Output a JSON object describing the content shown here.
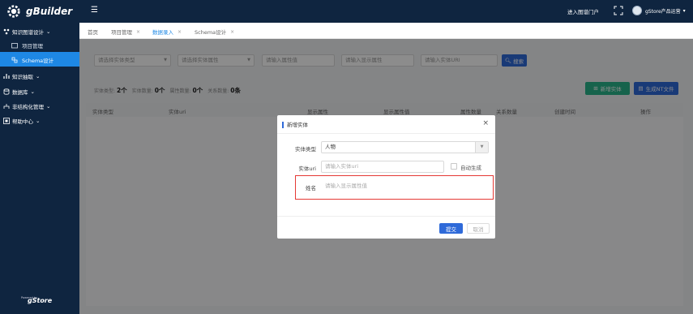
{
  "app": {
    "brand": "gBuilder",
    "footer_brand": "gStore",
    "footer_small": "Powered by"
  },
  "header": {
    "portal_link": "进入图谱门户",
    "user_name": "gStore产品运营"
  },
  "sidebar": {
    "groups": [
      {
        "label": "知识图谱设计",
        "icon": "graph-icon"
      },
      {
        "label": "知识抽取",
        "icon": "chart-icon"
      },
      {
        "label": "数据库",
        "icon": "database-icon"
      },
      {
        "label": "非结构化管理",
        "icon": "sitemap-icon"
      },
      {
        "label": "帮助中心",
        "icon": "help-icon"
      }
    ],
    "sub_items": [
      {
        "label": "项目管理",
        "icon": "folder-icon"
      },
      {
        "label": "Schema设计",
        "icon": "schema-icon"
      }
    ]
  },
  "tabs": [
    {
      "label": "首页"
    },
    {
      "label": "项目管理"
    },
    {
      "label": "数据录入"
    },
    {
      "label": "Schema设计"
    }
  ],
  "filters": {
    "entity_type_placeholder": "请选择实体类型",
    "entity_attr_placeholder": "请选择实体属性",
    "attr_value_placeholder": "请输入属性值",
    "display_attr_placeholder": "请输入显示属性",
    "entity_uri_placeholder": "请输入实体URI",
    "search_label": "搜索"
  },
  "stats": {
    "type_label": "实体类型:",
    "type_value": "2个",
    "entity_label": "实体数量:",
    "entity_value": "0个",
    "attr_label": "属性数量:",
    "attr_value": "0个",
    "relation_label": "关系数量:",
    "relation_value": "0条"
  },
  "actions": {
    "add_entity": "新增实体",
    "generate_nt": "生成NT文件"
  },
  "table": {
    "columns": [
      "实体类型",
      "实体uri",
      "显示属性",
      "显示属性值",
      "属性数量",
      "关系数量",
      "创建时间",
      "操作"
    ]
  },
  "modal": {
    "title": "新增实体",
    "entity_type_label": "实体类型",
    "entity_type_value": "人物",
    "entity_uri_label": "实体uri",
    "entity_uri_placeholder": "请输入实体uri",
    "auto_generate_label": "自动生成",
    "name_label": "姓名",
    "name_placeholder": "请输入显示属性值",
    "submit_label": "提交",
    "cancel_label": "取消"
  },
  "colors": {
    "sidebar_bg": "#0f2540",
    "accent": "#1e88e5",
    "primary_btn": "#2f6ad9",
    "success_btn": "#29b48b",
    "highlight_border": "#e53935"
  }
}
